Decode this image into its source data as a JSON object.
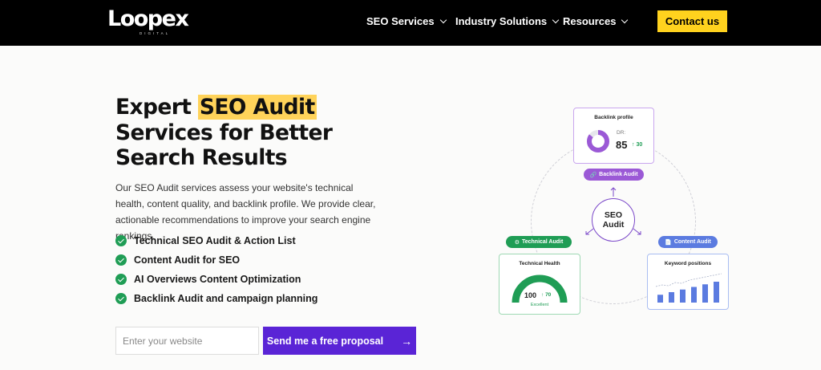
{
  "nav": {
    "logo": "Loopex",
    "logo_sub": "DIGITAL",
    "items": [
      {
        "label": "SEO Services"
      },
      {
        "label": "Industry Solutions"
      },
      {
        "label": "Resources"
      }
    ],
    "cta": "Contact us"
  },
  "hero": {
    "title_pre": "Expert ",
    "title_highlight": "SEO Audit",
    "title_post": " Services for Better Search Results",
    "description": "Our SEO Audit services assess your website's technical health, content quality, and backlink profile. We provide clear, actionable recommendations to improve your search engine rankings.",
    "checklist": [
      "Technical SEO Audit & Action List",
      "Content Audit for SEO",
      "AI Overviews Content Optimization",
      "Backlink Audit and campaign planning"
    ],
    "input_placeholder": "Enter your website",
    "button_label": "Send me a free proposal",
    "button_icon": "arrow-right-icon"
  },
  "diagram": {
    "center_line1": "SEO",
    "center_line2": "Audit",
    "backlink_card": {
      "title": "Backlink profile",
      "metric_label": "DR:",
      "metric_value": "85",
      "delta": "30",
      "donut_fill": 0.85
    },
    "backlink_pill": "Backlink Audit",
    "technical_pill": "Technical Audit",
    "technical_card": {
      "title": "Technical Health",
      "value": "100",
      "delta": "70",
      "status": "Excellent"
    },
    "content_pill": "Content Audit",
    "content_card": {
      "title": "Keyword positions",
      "bars": [
        3,
        4,
        5,
        6,
        7,
        8
      ]
    },
    "colors": {
      "purple": "#9b59d6",
      "green": "#1f9d55",
      "blue": "#5b7be0"
    }
  }
}
